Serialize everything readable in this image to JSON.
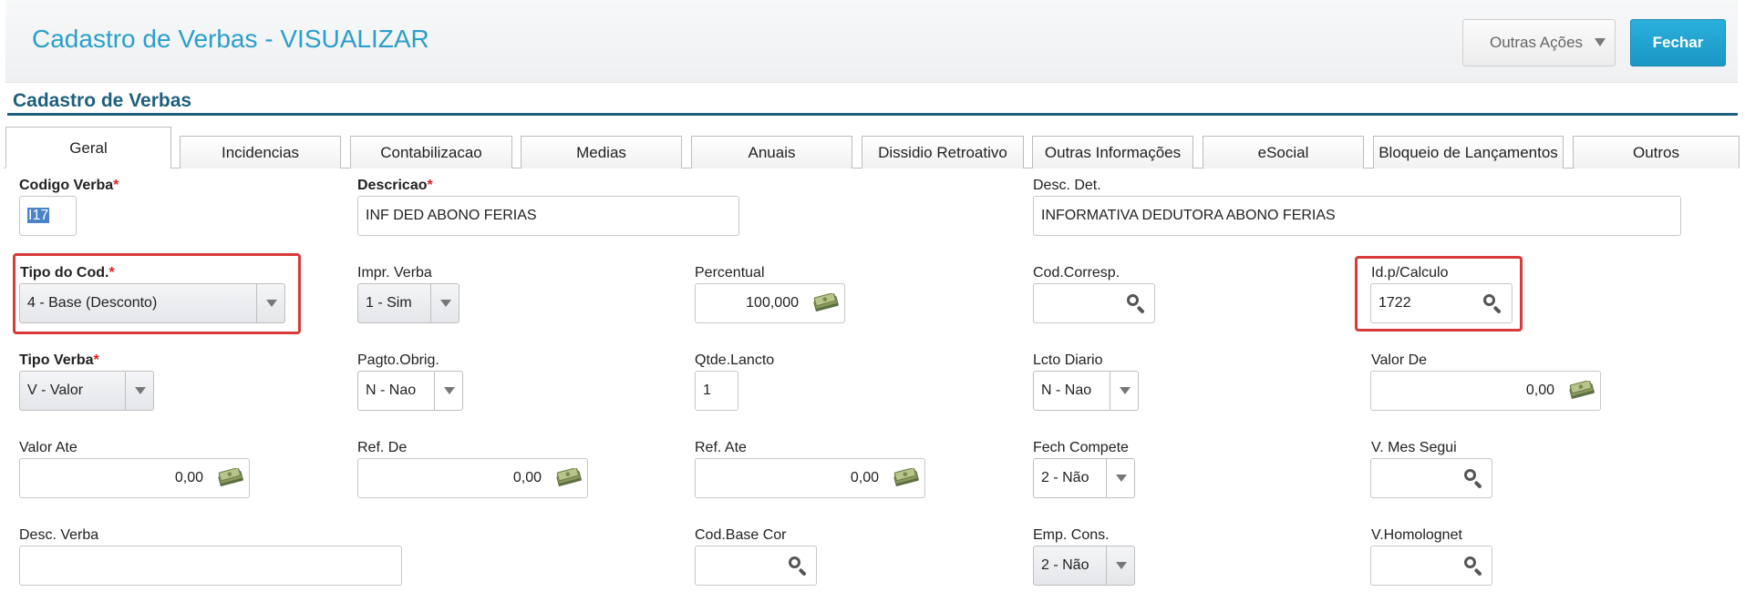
{
  "header": {
    "title": "Cadastro de Verbas - VISUALIZAR",
    "outras_acoes": "Outras Ações",
    "fechar": "Fechar"
  },
  "section": {
    "title": "Cadastro de Verbas"
  },
  "tabs": [
    {
      "label": "Geral",
      "active": true
    },
    {
      "label": "Incidencias"
    },
    {
      "label": "Contabilizacao"
    },
    {
      "label": "Medias"
    },
    {
      "label": "Anuais"
    },
    {
      "label": "Dissidio Retroativo"
    },
    {
      "label": "Outras Informações"
    },
    {
      "label": "eSocial"
    },
    {
      "label": "Bloqueio de Lançamentos"
    },
    {
      "label": "Outros"
    }
  ],
  "fields": {
    "codigo_verba": {
      "label": "Codigo Verba",
      "required_mark": "*",
      "value": "I17"
    },
    "descricao": {
      "label": "Descricao",
      "required_mark": "*",
      "value": "INF DED ABONO FERIAS"
    },
    "desc_det": {
      "label": "Desc. Det.",
      "value": "INFORMATIVA DEDUTORA ABONO FERIAS"
    },
    "tipo_cod": {
      "label": "Tipo do Cod.",
      "required_mark": "*",
      "value": "4 - Base (Desconto)"
    },
    "impr_verba": {
      "label": "Impr. Verba",
      "value": "1 - Sim"
    },
    "percentual": {
      "label": "Percentual",
      "value": "100,000"
    },
    "cod_corresp": {
      "label": "Cod.Corresp.",
      "value": ""
    },
    "id_calculo": {
      "label": "Id.p/Calculo",
      "value": "1722"
    },
    "tipo_verba": {
      "label": "Tipo Verba",
      "required_mark": "*",
      "value": "V - Valor"
    },
    "pagto_obrig": {
      "label": "Pagto.Obrig.",
      "value": "N - Nao"
    },
    "qtde_lancto": {
      "label": "Qtde.Lancto",
      "value": "1"
    },
    "lcto_diario": {
      "label": "Lcto Diario",
      "value": "N - Nao"
    },
    "valor_de": {
      "label": "Valor De",
      "value": "0,00"
    },
    "valor_ate": {
      "label": "Valor Ate",
      "value": "0,00"
    },
    "ref_de": {
      "label": "Ref. De",
      "value": "0,00"
    },
    "ref_ate": {
      "label": "Ref. Ate",
      "value": "0,00"
    },
    "fech_compete": {
      "label": "Fech Compete",
      "value": "2 - Não"
    },
    "v_mes_segui": {
      "label": "V. Mes Segui",
      "value": ""
    },
    "desc_verba": {
      "label": "Desc. Verba",
      "value": ""
    },
    "cod_base_cor": {
      "label": "Cod.Base Cor",
      "value": ""
    },
    "emp_cons": {
      "label": "Emp. Cons.",
      "value": "2 - Não"
    },
    "v_homolognet": {
      "label": "V.Homolognet",
      "value": ""
    }
  },
  "colors": {
    "accent": "#2a9fc9",
    "section": "#1f5f7e",
    "highlight": "#d93a3a",
    "required": "#e02020"
  },
  "icons": [
    "search-icon",
    "money-icon",
    "chevron-down-icon"
  ]
}
